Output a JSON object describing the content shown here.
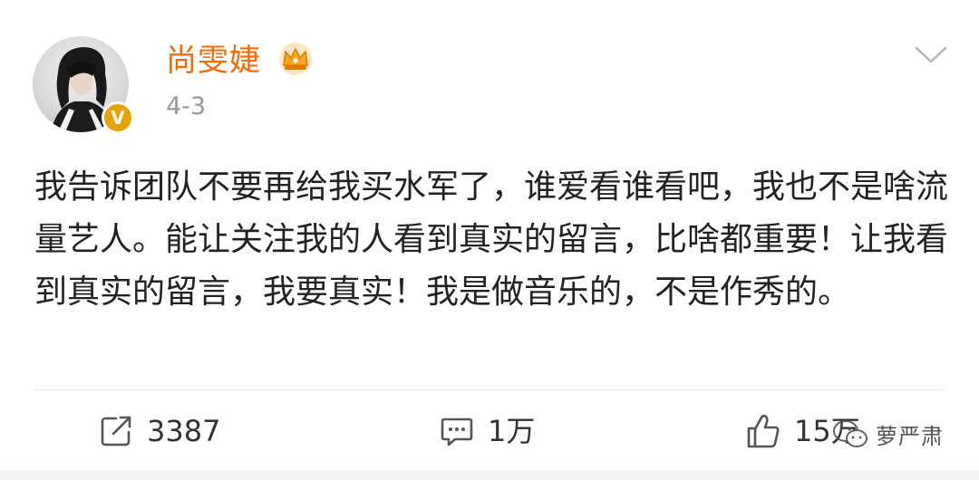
{
  "post": {
    "username": "尚雯婕",
    "date": "4-3",
    "text": "我告诉团队不要再给我买水军了，谁爱看谁看吧，我也不是啥流量艺人。能让关注我的人看到真实的留言，比啥都重要！让我看到真实的留言，我要真实！我是做音乐的，不是作秀的。",
    "badge": "V"
  },
  "actions": {
    "repost_count": "3387",
    "comment_count": "1万",
    "like_count": "15万"
  },
  "watermark": {
    "text": "萝严肃"
  },
  "colors": {
    "username": "#f76b00",
    "badge": "#e8a300",
    "crown": "#f5a623",
    "muted": "#999999",
    "icon": "#555555"
  },
  "icons": [
    "crown-icon",
    "chevron-down-icon",
    "repost-icon",
    "comment-icon",
    "like-icon",
    "wechat-icon"
  ]
}
